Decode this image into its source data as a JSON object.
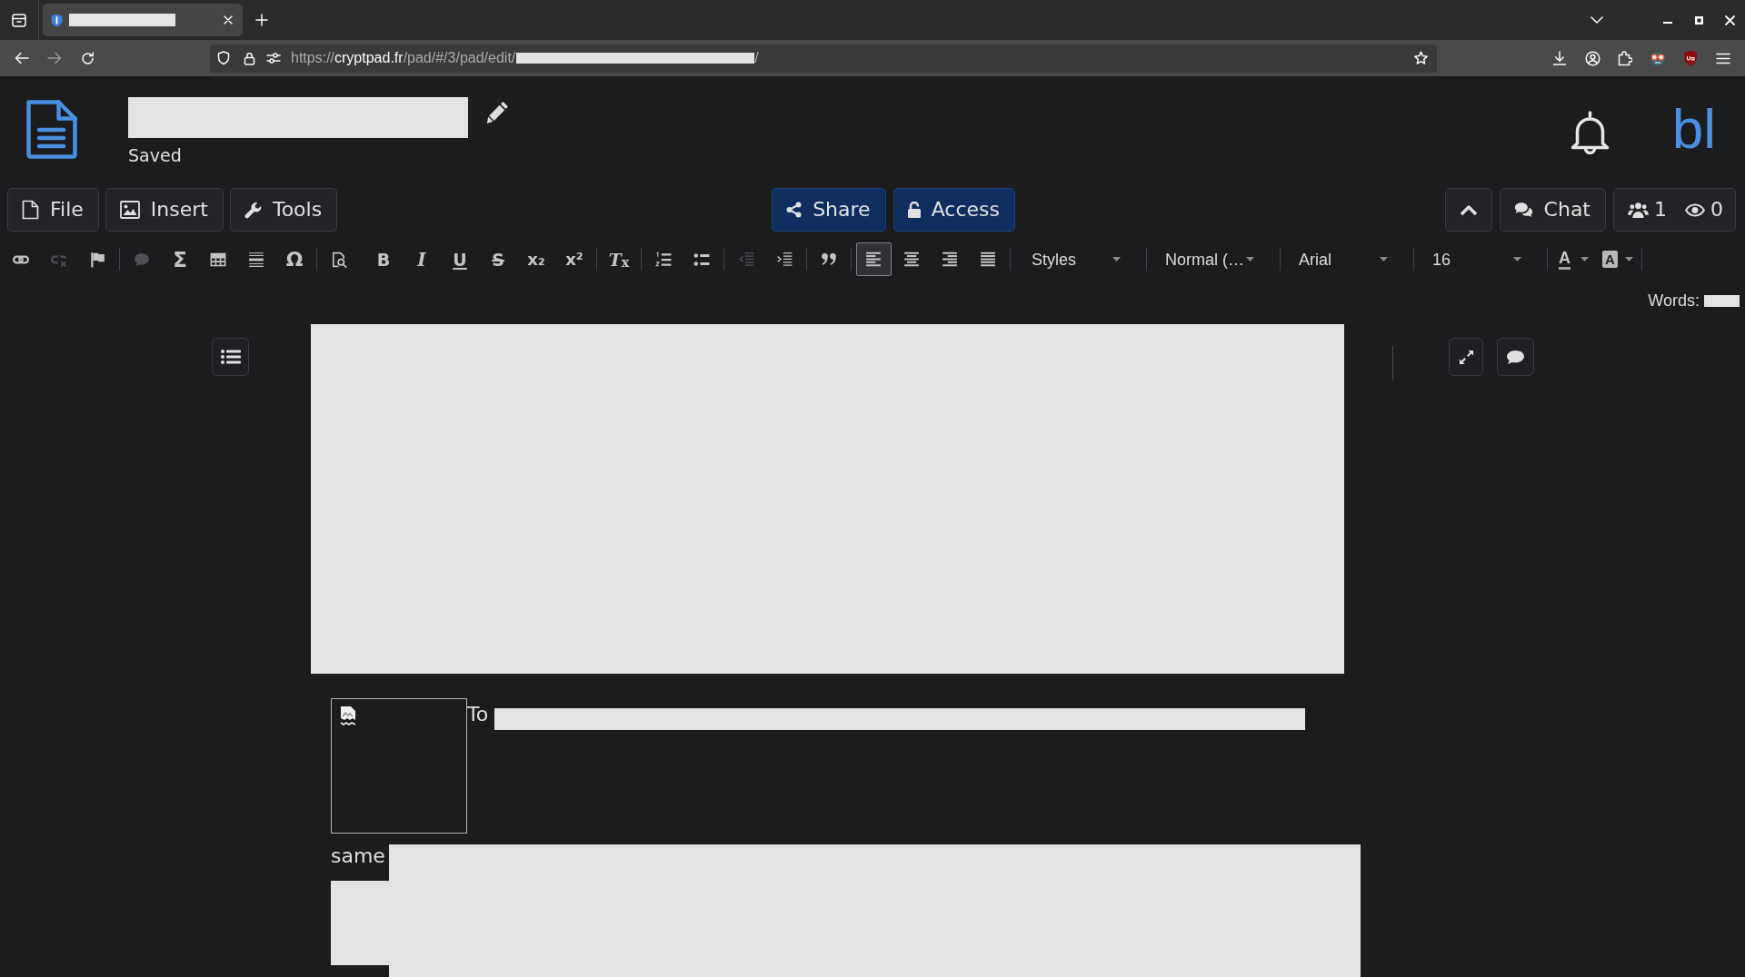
{
  "browser": {
    "tabs": [
      {
        "selected": true
      }
    ],
    "url": {
      "scheme": "https://",
      "host": "cryptpad.fr",
      "path": "/pad/#/3/pad/edit/",
      "end": "/"
    }
  },
  "header": {
    "status": "Saved",
    "avatar": "bl"
  },
  "toolbar": {
    "left_buttons": [
      {
        "kind": "file",
        "label": "File"
      },
      {
        "kind": "insert",
        "label": "Insert"
      },
      {
        "kind": "tools",
        "label": "Tools"
      }
    ],
    "center_buttons": [
      {
        "kind": "share",
        "label": "Share"
      },
      {
        "kind": "access",
        "label": "Access"
      }
    ],
    "chat_button": {
      "label": "Chat"
    },
    "users_button": {
      "editors": "1",
      "viewers": "0"
    }
  },
  "editor_toolbar": {
    "groups": [
      {
        "divider": true,
        "buttons": [
          {
            "kind": "link",
            "disabled": false,
            "on": false
          },
          {
            "kind": "unlink",
            "disabled": true,
            "on": false
          },
          {
            "kind": "anchor",
            "disabled": false,
            "on": false
          }
        ]
      },
      {
        "divider": true,
        "buttons": [
          {
            "kind": "comment",
            "disabled": true,
            "on": false
          },
          {
            "kind": "formula",
            "glyph": "Σ",
            "disabled": false,
            "on": false
          },
          {
            "kind": "table",
            "disabled": false,
            "on": false
          },
          {
            "kind": "rule",
            "disabled": false,
            "on": false
          },
          {
            "kind": "symbol",
            "glyph": "Ω",
            "disabled": false,
            "on": false
          }
        ]
      },
      {
        "divider": false,
        "buttons": [
          {
            "kind": "preview",
            "disabled": false,
            "on": false
          }
        ]
      },
      {
        "divider": true,
        "buttons": [
          {
            "kind": "bold",
            "glyph": "B",
            "disabled": false,
            "on": false
          },
          {
            "kind": "italic",
            "glyph": "I",
            "disabled": false,
            "on": false
          },
          {
            "kind": "underline",
            "glyph": "U",
            "disabled": false,
            "on": false
          },
          {
            "kind": "strike",
            "glyph": "S",
            "disabled": false,
            "on": false
          },
          {
            "kind": "subscript",
            "glyph": "x₂",
            "disabled": false,
            "on": false
          },
          {
            "kind": "superscript",
            "glyph": "x²",
            "disabled": false,
            "on": false
          }
        ]
      },
      {
        "divider": true,
        "buttons": [
          {
            "kind": "clear",
            "glyph": "*T*$_{x}$",
            "disabled": false,
            "on": false
          }
        ]
      },
      {
        "divider": true,
        "buttons": [
          {
            "kind": "numbered",
            "disabled": false,
            "on": false
          },
          {
            "kind": "bulleted",
            "disabled": false,
            "on": false
          }
        ]
      },
      {
        "divider": true,
        "buttons": [
          {
            "kind": "outdent",
            "disabled": true,
            "on": false
          },
          {
            "kind": "indent",
            "disabled": false,
            "on": false
          }
        ]
      },
      {
        "divider": true,
        "buttons": [
          {
            "kind": "quote",
            "disabled": false,
            "on": false
          }
        ]
      },
      {
        "divider": true,
        "buttons": [
          {
            "kind": "left",
            "disabled": false,
            "on": true
          },
          {
            "kind": "center",
            "disabled": false,
            "on": false
          },
          {
            "kind": "right",
            "disabled": false,
            "on": false
          },
          {
            "kind": "justify",
            "disabled": false,
            "on": false
          }
        ]
      }
    ],
    "dropdowns": [
      {
        "label": "Styles"
      },
      {
        "label": "Normal (…"
      },
      {
        "label": "Arial"
      },
      {
        "label": "16"
      }
    ],
    "color_buttons": [
      {
        "kind": "text",
        "glyph": "A"
      },
      {
        "kind": "background",
        "glyph": "A"
      }
    ]
  },
  "word_count": {
    "label": "Words:"
  },
  "document": {
    "lines": [
      {
        "text": "To"
      },
      {
        "text": "same"
      }
    ]
  }
}
